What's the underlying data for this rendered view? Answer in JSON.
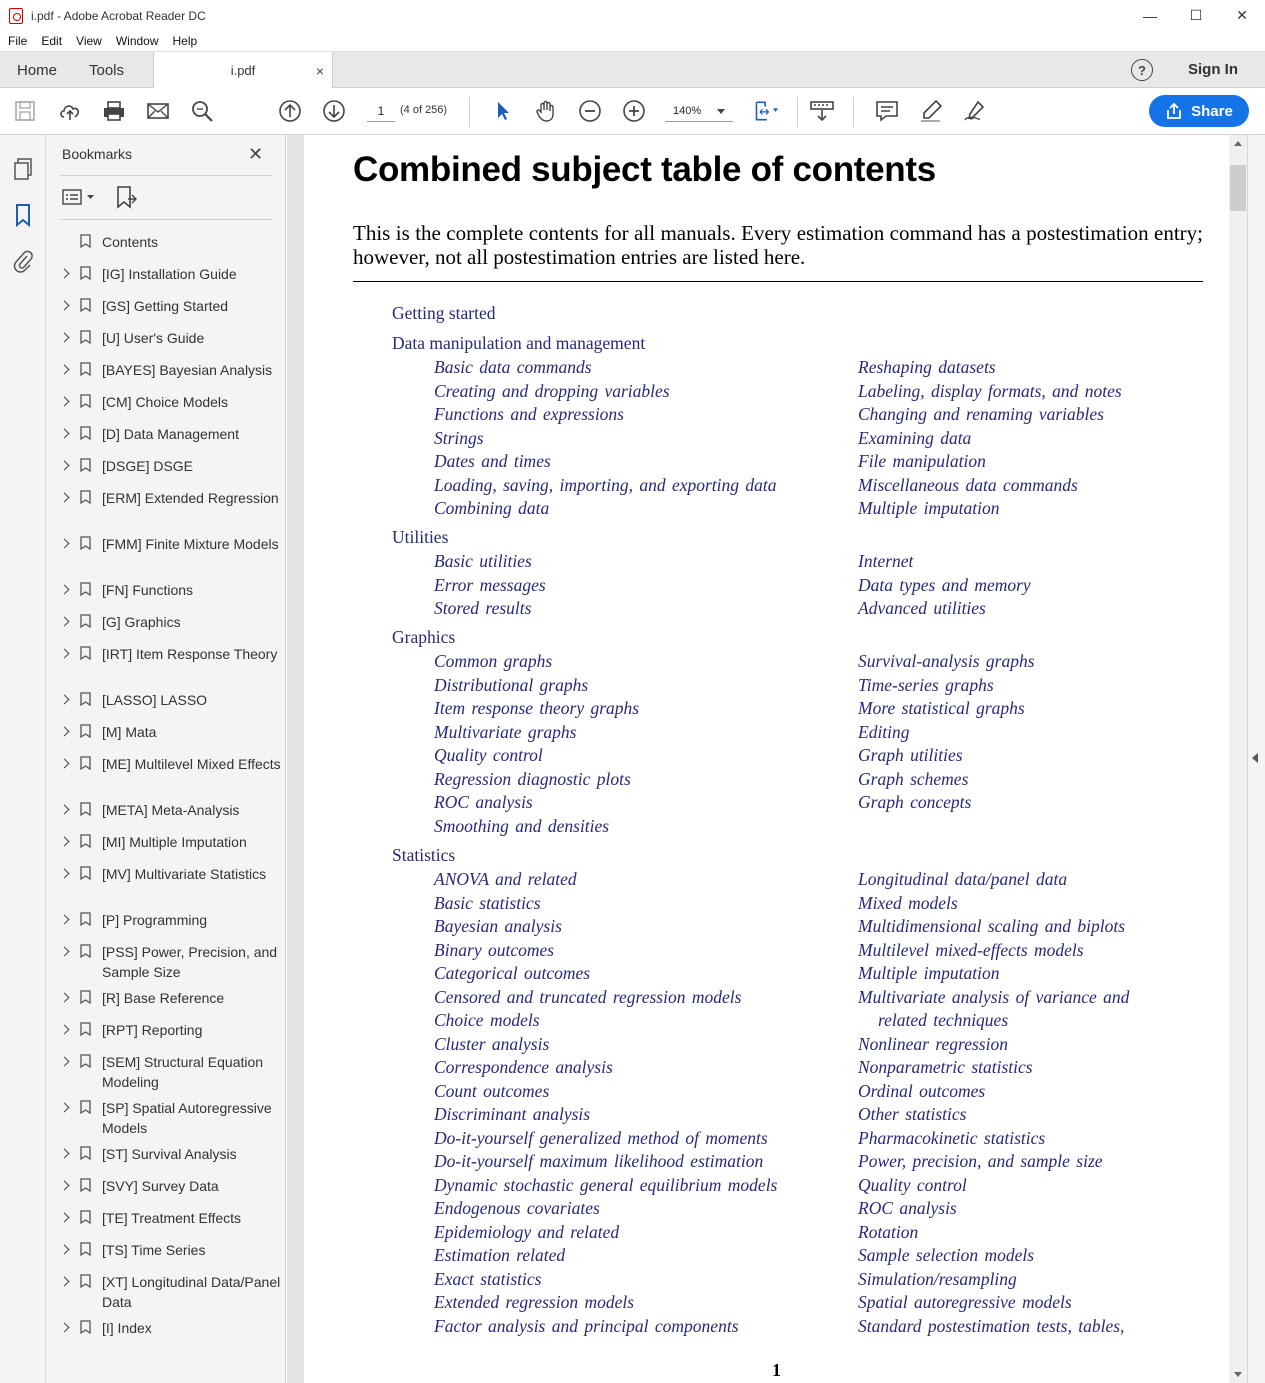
{
  "window": {
    "title": "i.pdf - Adobe Acrobat Reader DC",
    "minimize": "—",
    "maximize": "☐",
    "close": "✕"
  },
  "menu": [
    "File",
    "Edit",
    "View",
    "Window",
    "Help"
  ],
  "tabs": {
    "home": "Home",
    "tools": "Tools",
    "doc": "i.pdf",
    "doc_close": "×",
    "help": "?",
    "signin": "Sign In"
  },
  "toolbar": {
    "page_value": "1",
    "page_count": "(4 of 256)",
    "zoom": "140%",
    "share": "Share"
  },
  "bookmarks": {
    "title": "Bookmarks",
    "close": "✕",
    "items": [
      {
        "label": "Contents",
        "expandable": false
      },
      {
        "label": "[IG] Installation Guide",
        "expandable": true
      },
      {
        "label": "[GS] Getting Started",
        "expandable": true
      },
      {
        "label": "[U] User's Guide",
        "expandable": true
      },
      {
        "label": "[BAYES] Bayesian Analysis",
        "expandable": true
      },
      {
        "label": "[CM] Choice Models",
        "expandable": true
      },
      {
        "label": "[D] Data Management",
        "expandable": true
      },
      {
        "label": "[DSGE] DSGE",
        "expandable": true
      },
      {
        "label": "[ERM] Extended Regression",
        "expandable": true
      },
      {
        "label": "[FMM] Finite Mixture Models",
        "expandable": true
      },
      {
        "label": "[FN] Functions",
        "expandable": true
      },
      {
        "label": "[G] Graphics",
        "expandable": true
      },
      {
        "label": "[IRT] Item Response Theory",
        "expandable": true
      },
      {
        "label": "[LASSO] LASSO",
        "expandable": true
      },
      {
        "label": "[M] Mata",
        "expandable": true
      },
      {
        "label": "[ME] Multilevel Mixed Effects",
        "expandable": true
      },
      {
        "label": "[META] Meta-Analysis",
        "expandable": true
      },
      {
        "label": "[MI] Multiple Imputation",
        "expandable": true
      },
      {
        "label": "[MV] Multivariate Statistics",
        "expandable": true
      },
      {
        "label": "[P] Programming",
        "expandable": true
      },
      {
        "label": "[PSS] Power, Precision, and Sample Size",
        "expandable": true
      },
      {
        "label": "[R] Base Reference",
        "expandable": true
      },
      {
        "label": "[RPT] Reporting",
        "expandable": true
      },
      {
        "label": "[SEM] Structural Equation Modeling",
        "expandable": true
      },
      {
        "label": "[SP] Spatial Autoregressive Models",
        "expandable": true
      },
      {
        "label": "[ST] Survival Analysis",
        "expandable": true
      },
      {
        "label": "[SVY] Survey Data",
        "expandable": true
      },
      {
        "label": "[TE] Treatment Effects",
        "expandable": true
      },
      {
        "label": "[TS] Time Series",
        "expandable": true
      },
      {
        "label": "[XT] Longitudinal Data/Panel Data",
        "expandable": true
      },
      {
        "label": "[I] Index",
        "expandable": true
      }
    ]
  },
  "document": {
    "title": "Combined subject table of contents",
    "intro": "This is the complete contents for all manuals. Every estimation command has a postestimation entry; however, not all postestimation entries are listed here.",
    "page_number": "1",
    "sections": [
      {
        "name": "Getting started",
        "left": [],
        "right": []
      },
      {
        "name": "Data manipulation and management",
        "left": [
          "Basic data commands",
          "Creating and dropping variables",
          "Functions and expressions",
          "Strings",
          "Dates and times",
          "Loading, saving, importing, and exporting data",
          "Combining data"
        ],
        "right": [
          "Reshaping datasets",
          "Labeling, display formats, and notes",
          "Changing and renaming variables",
          "Examining data",
          "File manipulation",
          "Miscellaneous data commands",
          "Multiple imputation"
        ]
      },
      {
        "name": "Utilities",
        "left": [
          "Basic utilities",
          "Error messages",
          "Stored results"
        ],
        "right": [
          "Internet",
          "Data types and memory",
          "Advanced utilities"
        ]
      },
      {
        "name": "Graphics",
        "left": [
          "Common graphs",
          "Distributional graphs",
          "Item response theory graphs",
          "Multivariate graphs",
          "Quality control",
          "Regression diagnostic plots",
          "ROC analysis",
          "Smoothing and densities"
        ],
        "right": [
          "Survival-analysis graphs",
          "Time-series graphs",
          "More statistical graphs",
          "Editing",
          "Graph utilities",
          "Graph schemes",
          "Graph concepts"
        ]
      },
      {
        "name": "Statistics",
        "left": [
          "ANOVA and related",
          "Basic statistics",
          "Bayesian analysis",
          "Binary outcomes",
          "Categorical outcomes",
          "Censored and truncated regression models",
          "Choice models",
          "Cluster analysis",
          "Correspondence analysis",
          "Count outcomes",
          "Discriminant analysis",
          "Do-it-yourself generalized method of moments",
          "Do-it-yourself maximum likelihood estimation",
          "Dynamic stochastic general equilibrium models",
          "Endogenous covariates",
          "Epidemiology and related",
          "Estimation related",
          "Exact statistics",
          "Extended regression models",
          "Factor analysis and principal components"
        ],
        "right": [
          "Longitudinal data/panel data",
          "Mixed models",
          "Multidimensional scaling and biplots",
          "Multilevel mixed-effects models",
          "Multiple imputation",
          "Multivariate analysis of variance and",
          "related techniques",
          "Nonlinear regression",
          "Nonparametric statistics",
          "Ordinal outcomes",
          "Other statistics",
          "Pharmacokinetic statistics",
          "Power, precision, and sample size",
          "Quality control",
          "ROC analysis",
          "Rotation",
          "Sample selection models",
          "Simulation/resampling",
          "Spatial autoregressive models",
          "Standard postestimation tests, tables,"
        ]
      }
    ]
  }
}
